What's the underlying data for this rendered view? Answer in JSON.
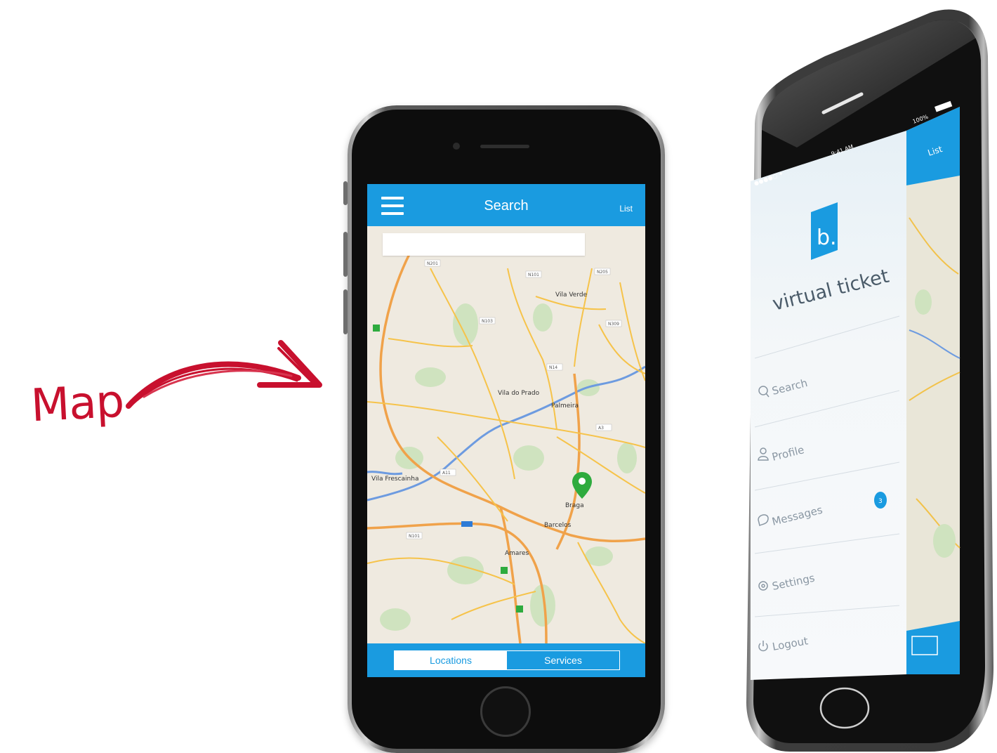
{
  "annotation": {
    "label": "Map"
  },
  "front_phone": {
    "header": {
      "title": "Search",
      "action_label": "List"
    },
    "search": {
      "placeholder": ""
    },
    "map": {
      "marker_place": "Braga",
      "place_labels": [
        "Vila Verde",
        "Vila do Prado",
        "Palmeira",
        "Barcelos",
        "Amares",
        "Vila Frescainha"
      ],
      "road_labels": [
        "N201",
        "N101",
        "N205",
        "N103",
        "N309",
        "N14",
        "A3",
        "A11",
        "N101"
      ]
    },
    "tabs": [
      {
        "label": "Locations",
        "active": true
      },
      {
        "label": "Services",
        "active": false
      }
    ],
    "colors": {
      "accent": "#1a9be0",
      "marker": "#2eab3e",
      "water": "#5b8fd6",
      "road": "#f2b43c"
    }
  },
  "side_phone": {
    "status_bar": {
      "time": "9:41 AM",
      "battery": "100%"
    },
    "header_action": "List",
    "brand": {
      "logo_glyph": "b.",
      "name": "virtual ticket"
    },
    "menu": [
      {
        "label": "Search",
        "icon": "search-icon"
      },
      {
        "label": "Profile",
        "icon": "user-icon"
      },
      {
        "label": "Messages",
        "icon": "chat-icon",
        "badge": "3"
      },
      {
        "label": "Settings",
        "icon": "gear-icon"
      },
      {
        "label": "Logout",
        "icon": "power-icon"
      }
    ]
  }
}
